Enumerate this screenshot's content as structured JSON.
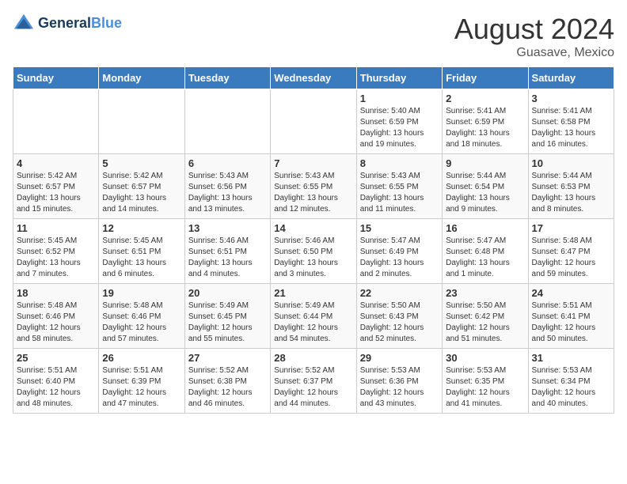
{
  "logo": {
    "line1": "General",
    "line2": "Blue"
  },
  "title": "August 2024",
  "location": "Guasave, Mexico",
  "days_of_week": [
    "Sunday",
    "Monday",
    "Tuesday",
    "Wednesday",
    "Thursday",
    "Friday",
    "Saturday"
  ],
  "weeks": [
    [
      {
        "day": "",
        "info": ""
      },
      {
        "day": "",
        "info": ""
      },
      {
        "day": "",
        "info": ""
      },
      {
        "day": "",
        "info": ""
      },
      {
        "day": "1",
        "info": "Sunrise: 5:40 AM\nSunset: 6:59 PM\nDaylight: 13 hours\nand 19 minutes."
      },
      {
        "day": "2",
        "info": "Sunrise: 5:41 AM\nSunset: 6:59 PM\nDaylight: 13 hours\nand 18 minutes."
      },
      {
        "day": "3",
        "info": "Sunrise: 5:41 AM\nSunset: 6:58 PM\nDaylight: 13 hours\nand 16 minutes."
      }
    ],
    [
      {
        "day": "4",
        "info": "Sunrise: 5:42 AM\nSunset: 6:57 PM\nDaylight: 13 hours\nand 15 minutes."
      },
      {
        "day": "5",
        "info": "Sunrise: 5:42 AM\nSunset: 6:57 PM\nDaylight: 13 hours\nand 14 minutes."
      },
      {
        "day": "6",
        "info": "Sunrise: 5:43 AM\nSunset: 6:56 PM\nDaylight: 13 hours\nand 13 minutes."
      },
      {
        "day": "7",
        "info": "Sunrise: 5:43 AM\nSunset: 6:55 PM\nDaylight: 13 hours\nand 12 minutes."
      },
      {
        "day": "8",
        "info": "Sunrise: 5:43 AM\nSunset: 6:55 PM\nDaylight: 13 hours\nand 11 minutes."
      },
      {
        "day": "9",
        "info": "Sunrise: 5:44 AM\nSunset: 6:54 PM\nDaylight: 13 hours\nand 9 minutes."
      },
      {
        "day": "10",
        "info": "Sunrise: 5:44 AM\nSunset: 6:53 PM\nDaylight: 13 hours\nand 8 minutes."
      }
    ],
    [
      {
        "day": "11",
        "info": "Sunrise: 5:45 AM\nSunset: 6:52 PM\nDaylight: 13 hours\nand 7 minutes."
      },
      {
        "day": "12",
        "info": "Sunrise: 5:45 AM\nSunset: 6:51 PM\nDaylight: 13 hours\nand 6 minutes."
      },
      {
        "day": "13",
        "info": "Sunrise: 5:46 AM\nSunset: 6:51 PM\nDaylight: 13 hours\nand 4 minutes."
      },
      {
        "day": "14",
        "info": "Sunrise: 5:46 AM\nSunset: 6:50 PM\nDaylight: 13 hours\nand 3 minutes."
      },
      {
        "day": "15",
        "info": "Sunrise: 5:47 AM\nSunset: 6:49 PM\nDaylight: 13 hours\nand 2 minutes."
      },
      {
        "day": "16",
        "info": "Sunrise: 5:47 AM\nSunset: 6:48 PM\nDaylight: 13 hours\nand 1 minute."
      },
      {
        "day": "17",
        "info": "Sunrise: 5:48 AM\nSunset: 6:47 PM\nDaylight: 12 hours\nand 59 minutes."
      }
    ],
    [
      {
        "day": "18",
        "info": "Sunrise: 5:48 AM\nSunset: 6:46 PM\nDaylight: 12 hours\nand 58 minutes."
      },
      {
        "day": "19",
        "info": "Sunrise: 5:48 AM\nSunset: 6:46 PM\nDaylight: 12 hours\nand 57 minutes."
      },
      {
        "day": "20",
        "info": "Sunrise: 5:49 AM\nSunset: 6:45 PM\nDaylight: 12 hours\nand 55 minutes."
      },
      {
        "day": "21",
        "info": "Sunrise: 5:49 AM\nSunset: 6:44 PM\nDaylight: 12 hours\nand 54 minutes."
      },
      {
        "day": "22",
        "info": "Sunrise: 5:50 AM\nSunset: 6:43 PM\nDaylight: 12 hours\nand 52 minutes."
      },
      {
        "day": "23",
        "info": "Sunrise: 5:50 AM\nSunset: 6:42 PM\nDaylight: 12 hours\nand 51 minutes."
      },
      {
        "day": "24",
        "info": "Sunrise: 5:51 AM\nSunset: 6:41 PM\nDaylight: 12 hours\nand 50 minutes."
      }
    ],
    [
      {
        "day": "25",
        "info": "Sunrise: 5:51 AM\nSunset: 6:40 PM\nDaylight: 12 hours\nand 48 minutes."
      },
      {
        "day": "26",
        "info": "Sunrise: 5:51 AM\nSunset: 6:39 PM\nDaylight: 12 hours\nand 47 minutes."
      },
      {
        "day": "27",
        "info": "Sunrise: 5:52 AM\nSunset: 6:38 PM\nDaylight: 12 hours\nand 46 minutes."
      },
      {
        "day": "28",
        "info": "Sunrise: 5:52 AM\nSunset: 6:37 PM\nDaylight: 12 hours\nand 44 minutes."
      },
      {
        "day": "29",
        "info": "Sunrise: 5:53 AM\nSunset: 6:36 PM\nDaylight: 12 hours\nand 43 minutes."
      },
      {
        "day": "30",
        "info": "Sunrise: 5:53 AM\nSunset: 6:35 PM\nDaylight: 12 hours\nand 41 minutes."
      },
      {
        "day": "31",
        "info": "Sunrise: 5:53 AM\nSunset: 6:34 PM\nDaylight: 12 hours\nand 40 minutes."
      }
    ]
  ]
}
